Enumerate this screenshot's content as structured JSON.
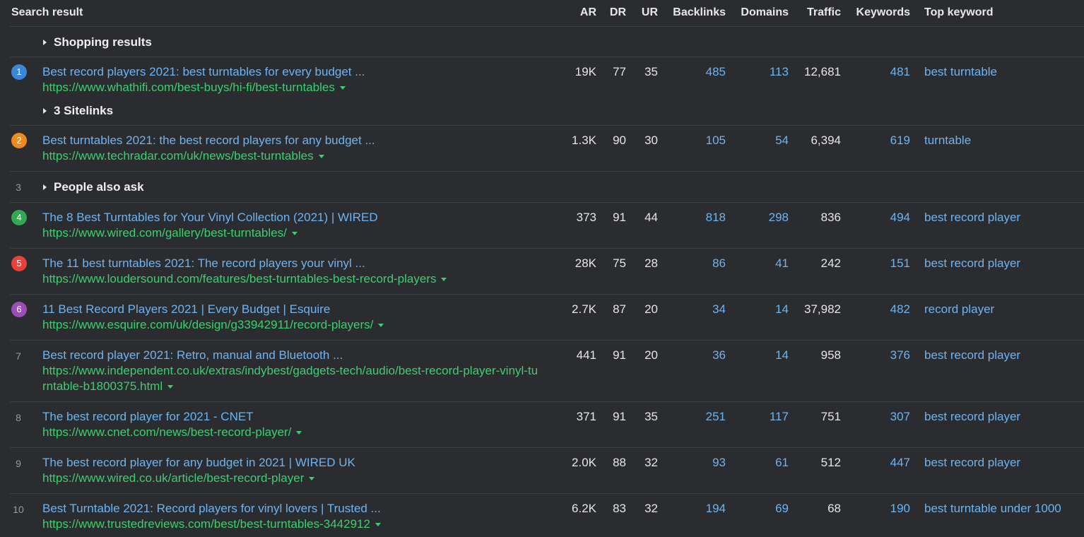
{
  "header": {
    "search_result": "Search result",
    "ar": "AR",
    "dr": "DR",
    "ur": "UR",
    "backlinks": "Backlinks",
    "domains": "Domains",
    "traffic": "Traffic",
    "keywords": "Keywords",
    "top_keyword": "Top keyword"
  },
  "features": {
    "shopping": "Shopping results",
    "sitelinks": "3 Sitelinks",
    "paa": "People also ask",
    "paa_pos": "3"
  },
  "badge_colors": {
    "blue": "#3a86d8",
    "orange": "#f08a1c",
    "green": "#34a853",
    "red": "#e8413a",
    "purple": "#9b4fb5"
  },
  "results": [
    {
      "pos": "1",
      "title": "Best record players 2021: best turntables for every budget ...",
      "url": "https://www.whathifi.com/best-buys/hi-fi/best-turntables",
      "ar": "19K",
      "dr": "77",
      "ur": "35",
      "backlinks": "485",
      "domains": "113",
      "traffic": "12,681",
      "keywords": "481",
      "top_keyword": "best turntable"
    },
    {
      "pos": "2",
      "title": "Best turntables 2021: the best record players for any budget ...",
      "url": "https://www.techradar.com/uk/news/best-turntables",
      "ar": "1.3K",
      "dr": "90",
      "ur": "30",
      "backlinks": "105",
      "domains": "54",
      "traffic": "6,394",
      "keywords": "619",
      "top_keyword": "turntable"
    },
    {
      "pos": "4",
      "title": "The 8 Best Turntables for Your Vinyl Collection (2021) | WIRED",
      "url": "https://www.wired.com/gallery/best-turntables/",
      "ar": "373",
      "dr": "91",
      "ur": "44",
      "backlinks": "818",
      "domains": "298",
      "traffic": "836",
      "keywords": "494",
      "top_keyword": "best record player"
    },
    {
      "pos": "5",
      "title": "The 11 best turntables 2021: The record players your vinyl ...",
      "url": "https://www.loudersound.com/features/best-turntables-best-record-players",
      "ar": "28K",
      "dr": "75",
      "ur": "28",
      "backlinks": "86",
      "domains": "41",
      "traffic": "242",
      "keywords": "151",
      "top_keyword": "best record player"
    },
    {
      "pos": "6",
      "title": "11 Best Record Players 2021 | Every Budget | Esquire",
      "url": "https://www.esquire.com/uk/design/g33942911/record-players/",
      "ar": "2.7K",
      "dr": "87",
      "ur": "20",
      "backlinks": "34",
      "domains": "14",
      "traffic": "37,982",
      "keywords": "482",
      "top_keyword": "record player"
    },
    {
      "pos": "7",
      "title": "Best record player 2021: Retro, manual and Bluetooth ...",
      "url_line1": "https://www.independent.co.uk/extras/indybest/gadgets-tech/audio/best-record-player-vinyl-tu",
      "url_line2": "rntable-b1800375.html",
      "ar": "441",
      "dr": "91",
      "ur": "20",
      "backlinks": "36",
      "domains": "14",
      "traffic": "958",
      "keywords": "376",
      "top_keyword": "best record player"
    },
    {
      "pos": "8",
      "title": "The best record player for 2021 - CNET",
      "url": "https://www.cnet.com/news/best-record-player/",
      "ar": "371",
      "dr": "91",
      "ur": "35",
      "backlinks": "251",
      "domains": "117",
      "traffic": "751",
      "keywords": "307",
      "top_keyword": "best record player"
    },
    {
      "pos": "9",
      "title": "The best record player for any budget in 2021 | WIRED UK",
      "url": "https://www.wired.co.uk/article/best-record-player",
      "ar": "2.0K",
      "dr": "88",
      "ur": "32",
      "backlinks": "93",
      "domains": "61",
      "traffic": "512",
      "keywords": "447",
      "top_keyword": "best record player"
    },
    {
      "pos": "10",
      "title": "Best Turntable 2021: Record players for vinyl lovers | Trusted ...",
      "url": "https://www.trustedreviews.com/best/best-turntables-3442912",
      "ar": "6.2K",
      "dr": "83",
      "ur": "32",
      "backlinks": "194",
      "domains": "69",
      "traffic": "68",
      "keywords": "190",
      "top_keyword": "best turntable under 1000"
    }
  ]
}
